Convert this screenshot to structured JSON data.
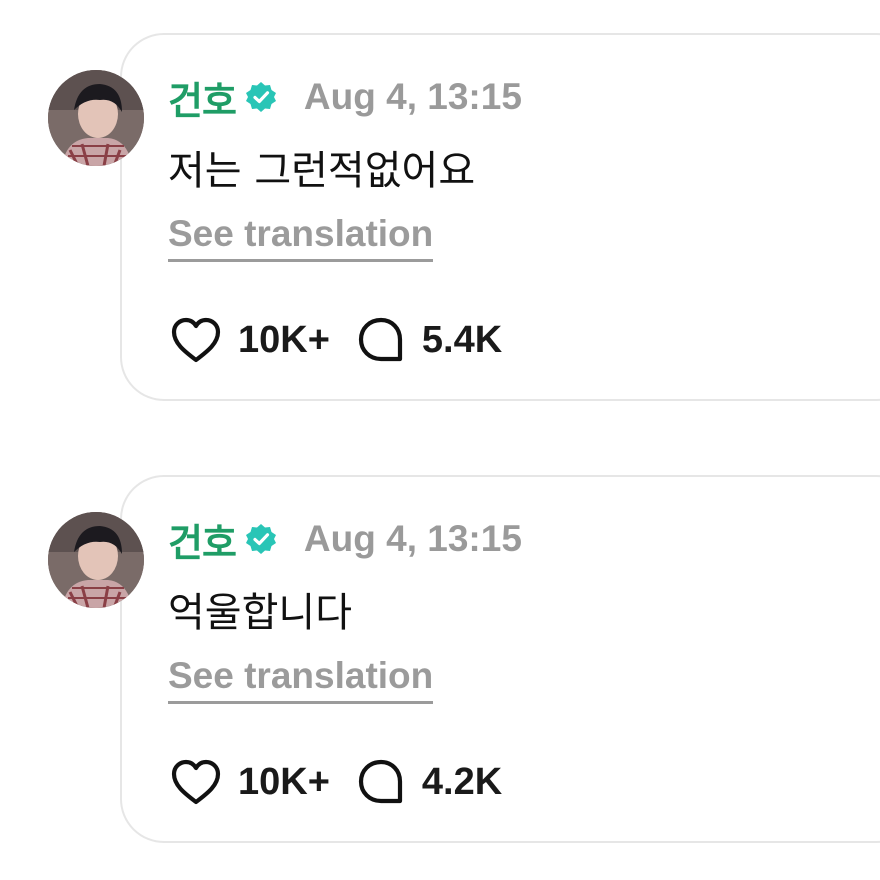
{
  "colors": {
    "author": "#1f9d66",
    "verified": "#29c5b6",
    "timestamp": "#9a9a9a",
    "translate": "#9b9b9b",
    "text": "#111111"
  },
  "posts": [
    {
      "author": "건호",
      "verified_icon": "verified-badge-icon",
      "timestamp": "Aug 4, 13:15",
      "text": "저는 그런적없어요",
      "translate_label": "See translation",
      "likes": "10K+",
      "replies": "5.4K",
      "like_icon": "heart-icon",
      "reply_icon": "comment-bubble-icon"
    },
    {
      "author": "건호",
      "verified_icon": "verified-badge-icon",
      "timestamp": "Aug 4, 13:15",
      "text": "억울합니다",
      "translate_label": "See translation",
      "likes": "10K+",
      "replies": "4.2K",
      "like_icon": "heart-icon",
      "reply_icon": "comment-bubble-icon"
    }
  ]
}
